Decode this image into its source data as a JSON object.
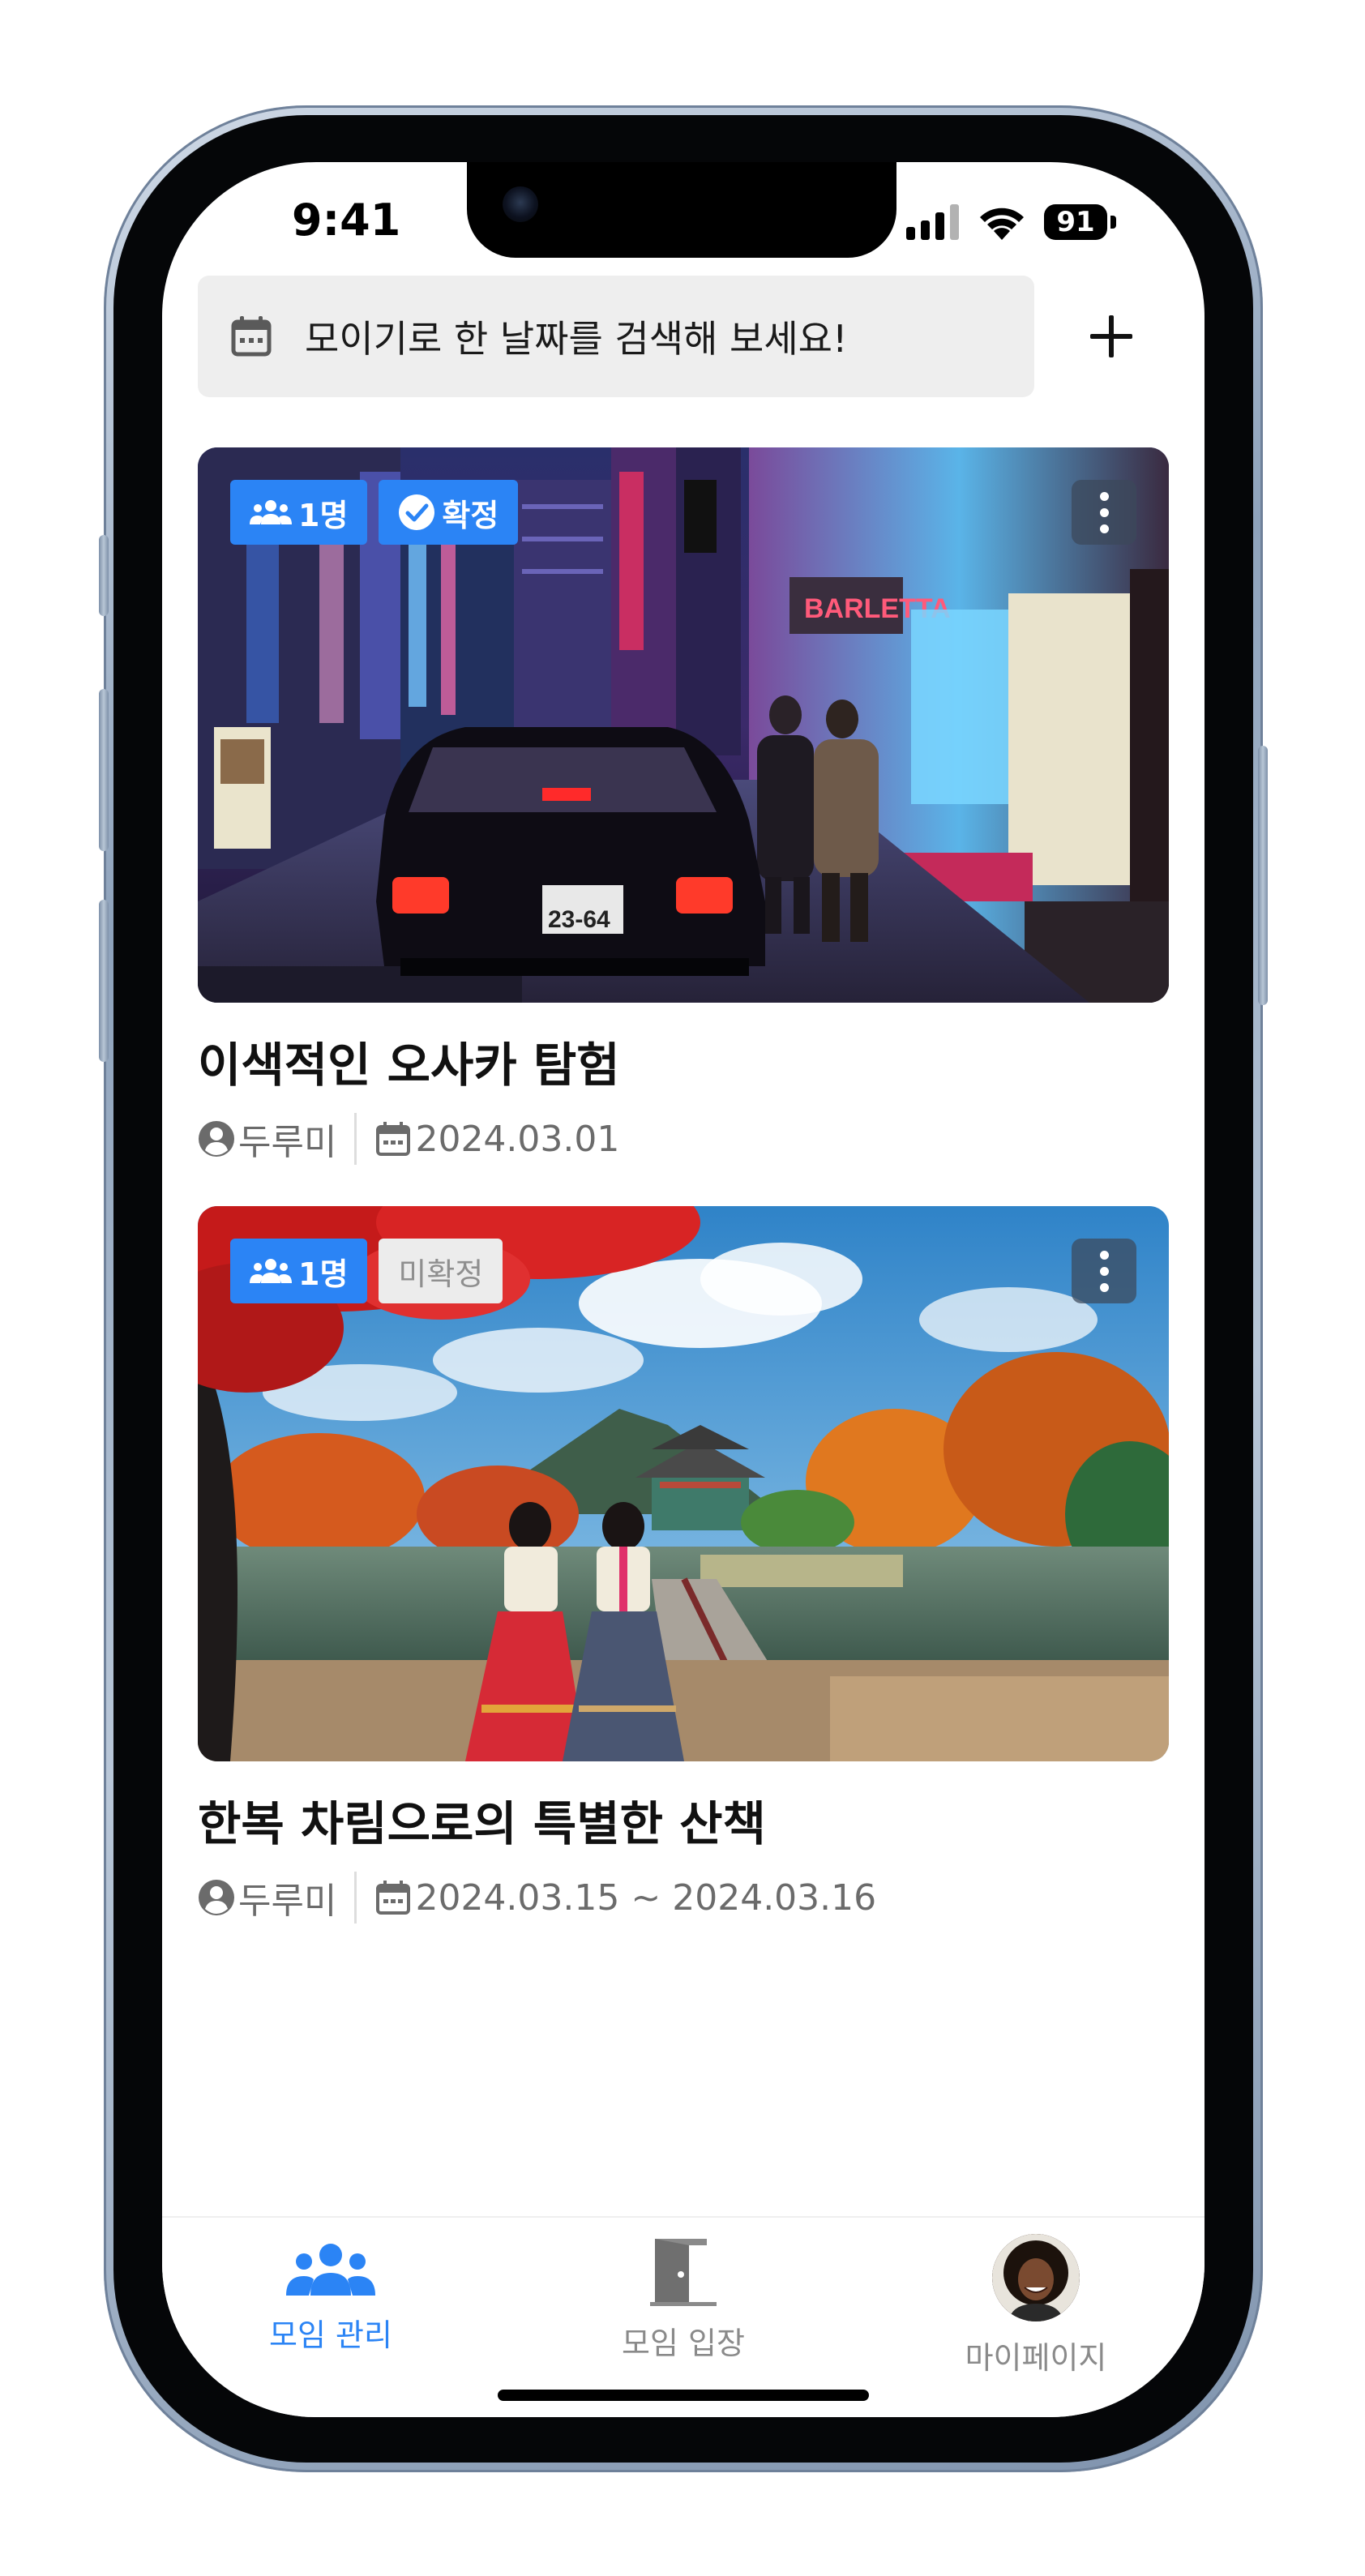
{
  "status_bar": {
    "time": "9:41",
    "battery": "91"
  },
  "search": {
    "text": "모이기로 한 날짜를 검색해 보세요!"
  },
  "cards": [
    {
      "title": "이색적인 오사카 탐험",
      "member_badge": "1명",
      "status_badge": "확정",
      "status_confirmed": true,
      "host": "두루미",
      "date": "2024.03.01",
      "image_desc": "osaka-night-street-taxi"
    },
    {
      "title": "한복 차림으로의 특별한 산책",
      "member_badge": "1명",
      "status_badge": "미확정",
      "status_confirmed": false,
      "host": "두루미",
      "date": "2024.03.15 ~ 2024.03.16",
      "image_desc": "hanbok-palace-autumn"
    }
  ],
  "tabbar": {
    "items": [
      {
        "label": "모임 관리",
        "icon": "group-icon",
        "active": true
      },
      {
        "label": "모임 입장",
        "icon": "door-icon",
        "active": false
      },
      {
        "label": "마이페이지",
        "icon": "avatar",
        "active": false
      }
    ]
  },
  "colors": {
    "accent": "#2b84f5",
    "inactive": "#8a8a8a",
    "search_bg": "#eeeeee"
  }
}
